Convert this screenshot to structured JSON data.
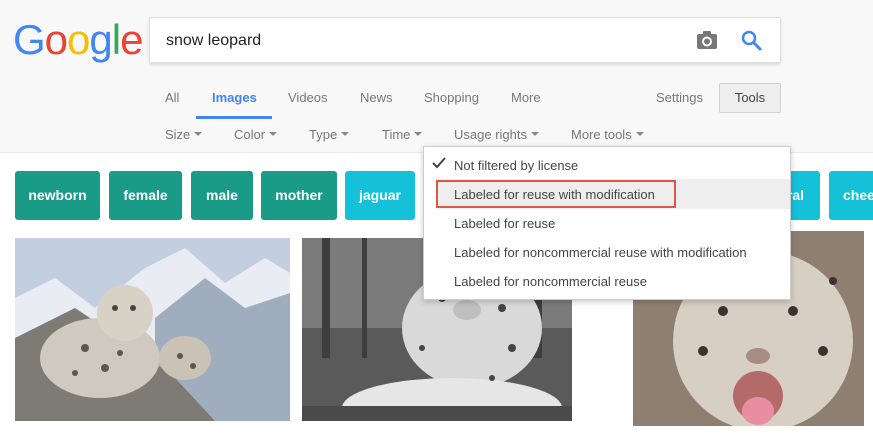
{
  "search": {
    "query": "snow leopard"
  },
  "logo": [
    "G",
    "o",
    "o",
    "g",
    "l",
    "e"
  ],
  "tabs": [
    "All",
    "Images",
    "Videos",
    "News",
    "Shopping",
    "More"
  ],
  "settings_label": "Settings",
  "tools_label": "Tools",
  "filters": [
    "Size",
    "Color",
    "Type",
    "Time",
    "Usage rights",
    "More tools"
  ],
  "chips": [
    "newborn",
    "female",
    "male",
    "mother",
    "jaguar",
    "ral",
    "chee"
  ],
  "usage_menu": [
    "Not filtered by license",
    "Labeled for reuse with modification",
    "Labeled for reuse",
    "Labeled for noncommercial reuse with modification",
    "Labeled for noncommercial reuse"
  ],
  "colors": {
    "blue": "#4285f4",
    "red": "#ea4335",
    "yellow": "#fbbc05",
    "green": "#34a853",
    "chip_dark": "#1a9b87",
    "chip_light": "#14c1d9",
    "highlight_box": "#e0574a"
  }
}
